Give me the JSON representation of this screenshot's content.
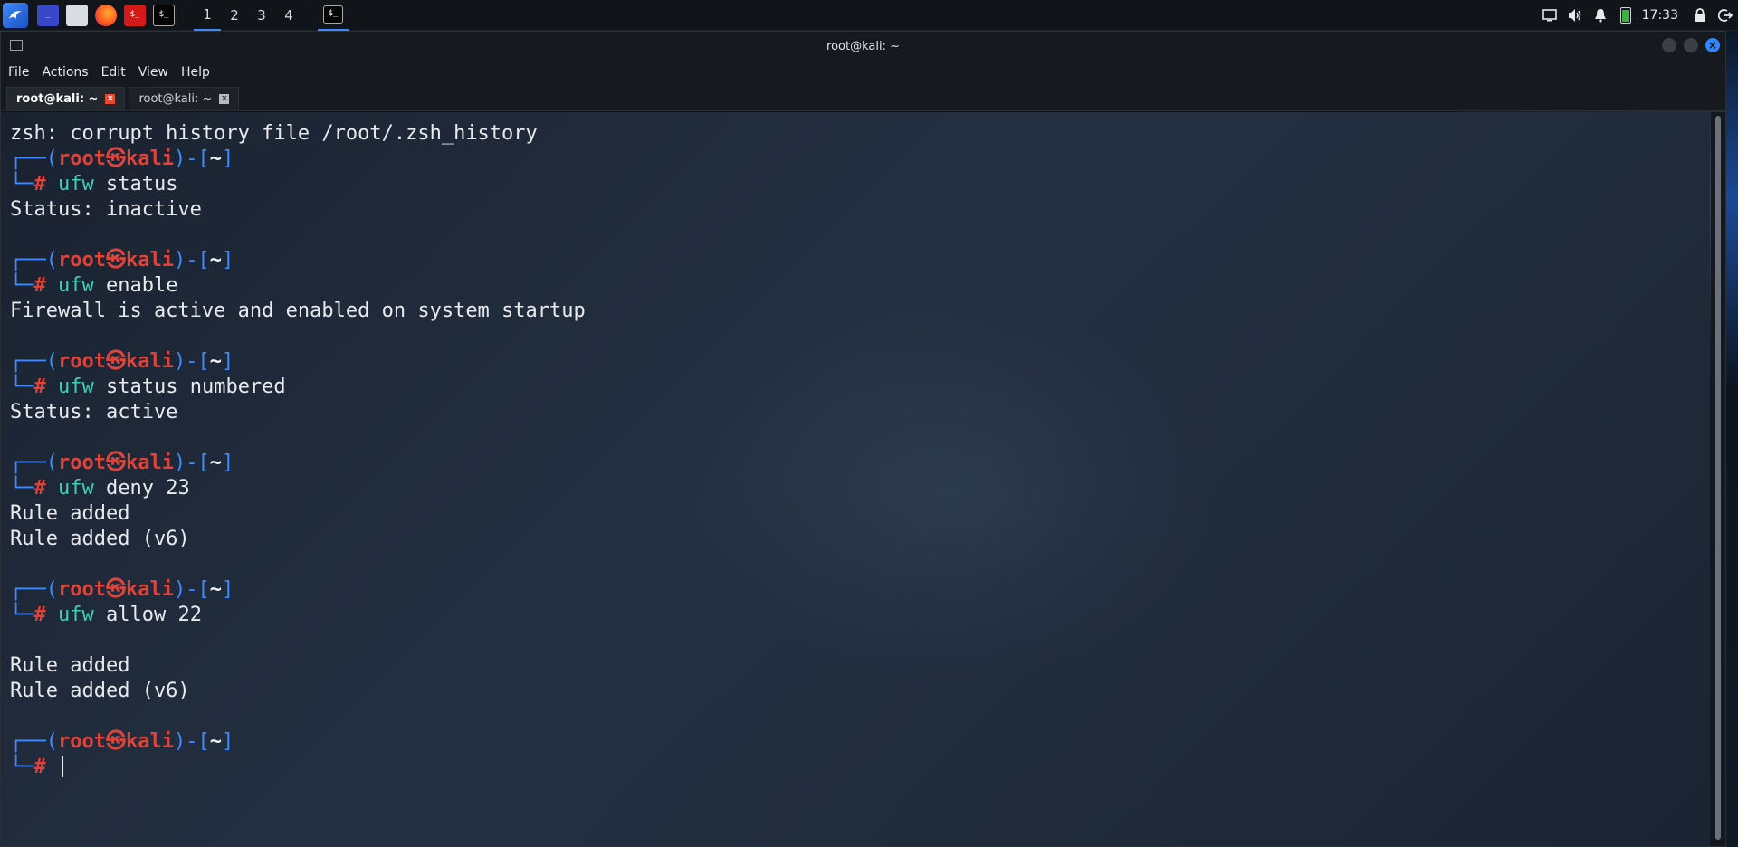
{
  "top_panel": {
    "workspaces": [
      "1",
      "2",
      "3",
      "4"
    ],
    "active_workspace": "1",
    "quick_launch": [
      "kali-menu-icon",
      "desktop-icon",
      "file-manager-icon",
      "firefox-icon",
      "red-app-icon",
      "terminal-icon"
    ],
    "clock": "17:33"
  },
  "window": {
    "title": "root@kali: ~",
    "menu": [
      "File",
      "Actions",
      "Edit",
      "View",
      "Help"
    ],
    "tabs": [
      {
        "label": "root@kali: ~",
        "active": true
      },
      {
        "label": "root@kali: ~",
        "active": false
      }
    ]
  },
  "prompt": {
    "user": "root",
    "skull": "㉿",
    "host": "kali",
    "dir": "~"
  },
  "terminal": {
    "intro": "zsh: corrupt history file /root/.zsh_history",
    "blocks": [
      {
        "cmd": "ufw",
        "args": " status",
        "output": [
          "Status: inactive",
          ""
        ]
      },
      {
        "cmd": "ufw",
        "args": " enable",
        "output": [
          "Firewall is active and enabled on system startup",
          ""
        ]
      },
      {
        "cmd": "ufw",
        "args": " status numbered",
        "output": [
          "Status: active",
          ""
        ]
      },
      {
        "cmd": "ufw",
        "args": " deny 23",
        "output": [
          "Rule added",
          "Rule added (v6)",
          ""
        ]
      },
      {
        "cmd": "ufw",
        "args": " allow 22",
        "output": [
          "",
          "Rule added",
          "Rule added (v6)",
          ""
        ]
      }
    ]
  },
  "colors": {
    "prompt_frame": "#3d8bff",
    "prompt_user_host": "#e0433a",
    "command": "#3fd0b8",
    "accent": "#2f86ff"
  }
}
